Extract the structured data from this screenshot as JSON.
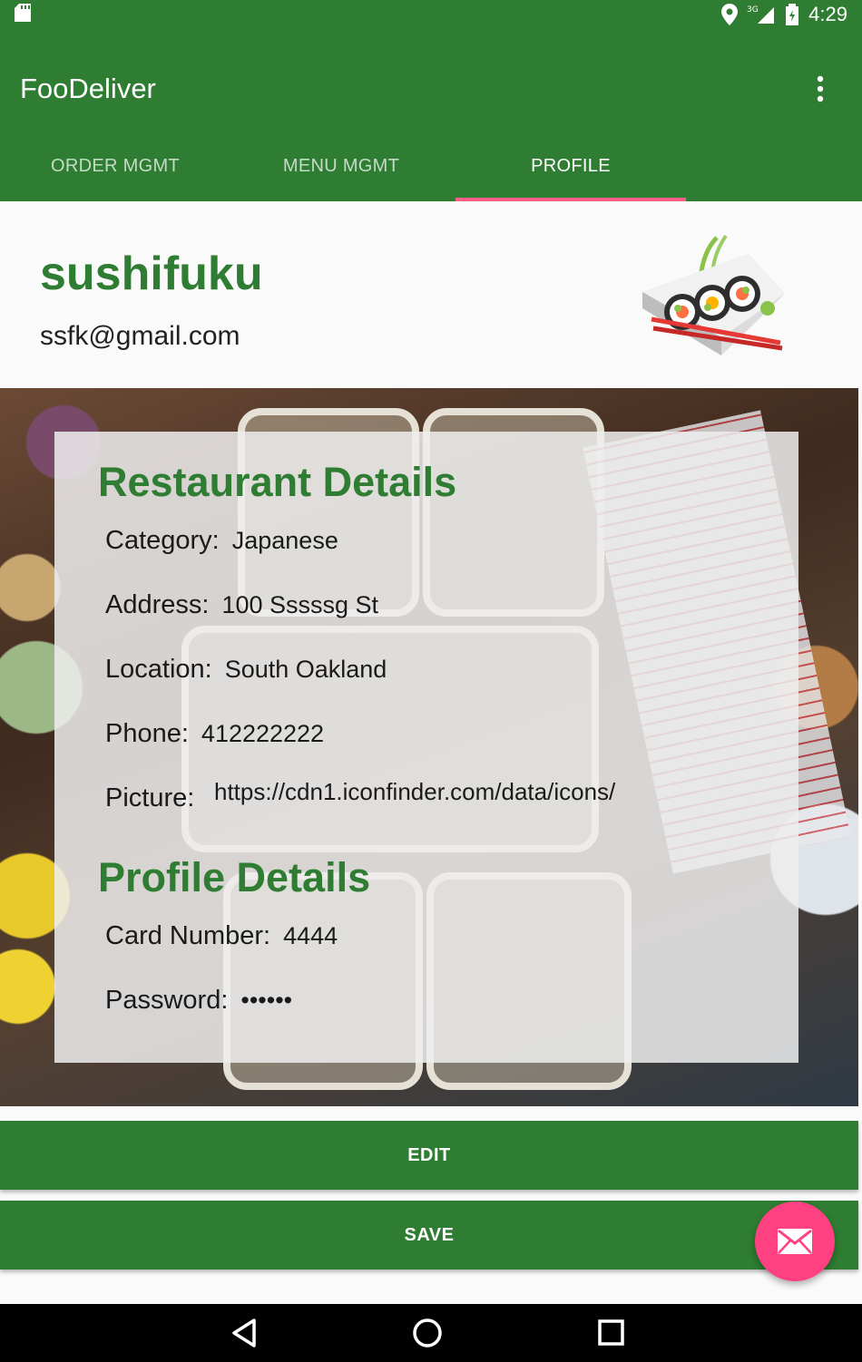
{
  "status_bar": {
    "time": "4:29",
    "network_label": "3G",
    "icons": [
      "sd-card-icon",
      "location-icon",
      "signal-icon",
      "battery-icon"
    ]
  },
  "app_bar": {
    "title": "FooDeliver",
    "overflow_icon": "more-vert-icon"
  },
  "tabs": [
    {
      "label": "ORDER MGMT",
      "active": false
    },
    {
      "label": "MENU MGMT",
      "active": false
    },
    {
      "label": "PROFILE",
      "active": true
    }
  ],
  "profile_header": {
    "name": "sushifuku",
    "email": "ssfk@gmail.com",
    "logo_icon": "sushi-logo-icon"
  },
  "restaurant_details": {
    "title": "Restaurant Details",
    "category": {
      "label": "Category:",
      "value": "Japanese"
    },
    "address": {
      "label": "Address:",
      "value": "100 Sssssg St"
    },
    "location": {
      "label": "Location:",
      "value": "South Oakland"
    },
    "phone": {
      "label": "Phone:",
      "value": "412222222"
    },
    "picture": {
      "label": "Picture:",
      "value": "https://cdn1.iconfinder.com/data/icons/"
    }
  },
  "profile_details": {
    "title": "Profile Details",
    "card_number": {
      "label": "Card Number:",
      "value": "4444"
    },
    "password": {
      "label": "Password:",
      "value": "••••••"
    }
  },
  "actions": {
    "edit_label": "EDIT",
    "save_label": "SAVE",
    "fab_icon": "email-icon"
  },
  "colors": {
    "primary": "#2e7d32",
    "accent": "#ff4081",
    "tab_indicator": "#ff5c86"
  },
  "nav_bar": {
    "icons": [
      "back-icon",
      "home-icon",
      "recents-icon"
    ]
  }
}
